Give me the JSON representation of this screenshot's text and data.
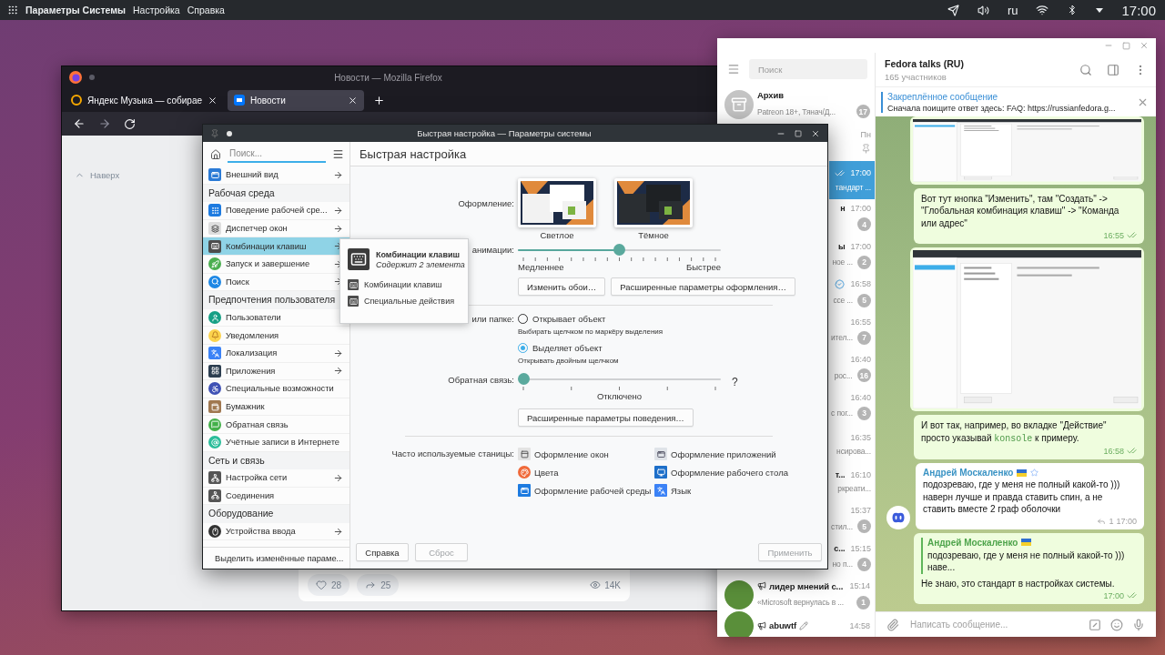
{
  "top_panel": {
    "app_title": "Параметры Системы",
    "menus": [
      "Настройка",
      "Справка"
    ],
    "keyboard_layout": "ru",
    "clock": "17:00"
  },
  "firefox": {
    "title": "Новости — Mozilla Firefox",
    "tabs": [
      {
        "label": "Яндекс Музыка — собирае",
        "selected": false
      },
      {
        "label": "Новости",
        "selected": true
      }
    ],
    "page": {
      "up_link": "Наверх",
      "likes": "28",
      "shares": "25",
      "views": "14K"
    }
  },
  "settings": {
    "title": "Быстрая настройка — Параметры системы",
    "search": {
      "placeholder": "Поиск..."
    },
    "sidebar": [
      {
        "kind": "item",
        "label": "Внешний вид",
        "arrow": true,
        "selected": false
      },
      {
        "kind": "header",
        "label": "Рабочая среда"
      },
      {
        "kind": "item",
        "label": "Поведение рабочей сре...",
        "arrow": true,
        "selected": false
      },
      {
        "kind": "item",
        "label": "Диспетчер окон",
        "arrow": true,
        "selected": false
      },
      {
        "kind": "item",
        "label": "Комбинации клавиш",
        "arrow": true,
        "selected": true
      },
      {
        "kind": "item",
        "label": "Запуск и завершение",
        "arrow": true,
        "selected": false
      },
      {
        "kind": "item",
        "label": "Поиск",
        "arrow": true,
        "selected": false
      },
      {
        "kind": "header",
        "label": "Предпочтения пользователя"
      },
      {
        "kind": "item",
        "label": "Пользователи",
        "arrow": false,
        "selected": false
      },
      {
        "kind": "item",
        "label": "Уведомления",
        "arrow": false,
        "selected": false
      },
      {
        "kind": "item",
        "label": "Локализация",
        "arrow": true,
        "selected": false
      },
      {
        "kind": "item",
        "label": "Приложения",
        "arrow": true,
        "selected": false
      },
      {
        "kind": "item",
        "label": "Специальные возможности",
        "arrow": false,
        "selected": false
      },
      {
        "kind": "item",
        "label": "Бумажник",
        "arrow": false,
        "selected": false
      },
      {
        "kind": "item",
        "label": "Обратная связь",
        "arrow": false,
        "selected": false
      },
      {
        "kind": "item",
        "label": "Учётные записи в Интернете",
        "arrow": false,
        "selected": false
      },
      {
        "kind": "header",
        "label": "Сеть и связь"
      },
      {
        "kind": "item",
        "label": "Настройка сети",
        "arrow": true,
        "selected": false
      },
      {
        "kind": "item",
        "label": "Соединения",
        "arrow": false,
        "selected": false
      },
      {
        "kind": "header",
        "label": "Оборудование"
      },
      {
        "kind": "item",
        "label": "Устройства ввода",
        "arrow": true,
        "selected": false
      }
    ],
    "highlight_changed": "Выделить изменённые параме...",
    "popup": {
      "title": "Комбинации клавиш",
      "subtitle": "Содержит 2 элемента",
      "items": [
        "Комбинации клавиш",
        "Специальные действия"
      ]
    },
    "page_title": "Быстрая настройка",
    "theme": {
      "label": "Оформление:",
      "options": [
        {
          "label": "Светлое",
          "kind": "light"
        },
        {
          "label": "Тёмное",
          "kind": "dark"
        }
      ]
    },
    "animation": {
      "label": "анимации:",
      "level": 0.5,
      "min_label": "Медленнее",
      "max_label": "Быстрее"
    },
    "appearance_buttons": [
      "Изменить обои…",
      "Расширенные параметры оформления…"
    ],
    "click_behavior": {
      "label": "или папке:",
      "options": [
        {
          "label": "Открывает объект",
          "hint": "Выбирать щелчком по маркёру выделения",
          "selected": false
        },
        {
          "label": "Выделяет объект",
          "hint": "Открывать двойным щелчком",
          "selected": true
        }
      ]
    },
    "feedback": {
      "label": "Обратная связь:",
      "level": 0,
      "value_label": "Отключено",
      "help": "?"
    },
    "behavior_button": "Расширенные параметры поведения…",
    "frequent": {
      "label": "Часто используемые станицы:",
      "links": [
        "Оформление окон",
        "Оформление приложений",
        "Цвета",
        "Оформление рабочего стола",
        "Оформление рабочей среды",
        "Язык"
      ]
    },
    "footer_buttons": [
      {
        "label": "Справка",
        "disabled": false
      },
      {
        "label": "Сброс",
        "disabled": true
      },
      {
        "label": "Применить",
        "disabled": true
      }
    ]
  },
  "telegram": {
    "search": {
      "placeholder": "Поиск"
    },
    "chats": [
      {
        "kind": "full",
        "title": "Архив",
        "preview": "Patreon 18+, Тянач/Д...",
        "badge": "17",
        "selected": false,
        "pinned": false,
        "read": false,
        "verified": false,
        "channel": false
      },
      {
        "kind": "partial",
        "time": "Пн",
        "selected": false,
        "pinned": true,
        "read": false,
        "verified": false,
        "channel": false
      },
      {
        "kind": "partial",
        "time": "17:00",
        "preview": "тандарт ...",
        "selected": true,
        "pinned": false,
        "read": true,
        "verified": false,
        "channel": false
      },
      {
        "kind": "partial",
        "title": "н",
        "time": "17:00",
        "badge": "4",
        "selected": false,
        "pinned": false,
        "read": false,
        "verified": false,
        "channel": false
      },
      {
        "kind": "partial",
        "title": "ы",
        "time": "17:00",
        "preview": "ное ...",
        "badge": "2",
        "selected": false,
        "pinned": false,
        "read": false,
        "verified": false,
        "channel": false
      },
      {
        "kind": "partial",
        "time": "16:58",
        "preview": "ссе ...",
        "badge": "5",
        "selected": false,
        "pinned": false,
        "read": false,
        "verified": true,
        "channel": false
      },
      {
        "kind": "partial",
        "time": "16:55",
        "preview": "ител...",
        "badge": "7",
        "selected": false,
        "pinned": false,
        "read": false,
        "verified": false,
        "channel": false
      },
      {
        "kind": "partial",
        "time": "16:40",
        "preview": "рос...",
        "badge": "16",
        "selected": false,
        "pinned": false,
        "read": false,
        "verified": false,
        "channel": false
      },
      {
        "kind": "partial",
        "time": "16:40",
        "preview": "с пог...",
        "badge": "3",
        "selected": false,
        "pinned": false,
        "read": false,
        "verified": false,
        "channel": false
      },
      {
        "kind": "partial",
        "time": "16:35",
        "preview": "нсирова...",
        "selected": false,
        "pinned": false,
        "read": false,
        "verified": false,
        "channel": false
      },
      {
        "kind": "partial",
        "title": "т...",
        "time": "16:10",
        "preview": "ркреати...",
        "selected": false,
        "pinned": false,
        "read": false,
        "verified": false,
        "channel": false
      },
      {
        "kind": "partial",
        "time": "15:37",
        "preview": "стил...",
        "badge": "5",
        "selected": false,
        "pinned": false,
        "read": false,
        "verified": false,
        "channel": false
      },
      {
        "kind": "partial",
        "title": "с...",
        "time": "15:15",
        "preview": "но п...",
        "badge": "4",
        "selected": false,
        "pinned": false,
        "read": false,
        "verified": false,
        "channel": false
      },
      {
        "kind": "full",
        "title": "лидер мнений с...",
        "time": "15:14",
        "preview": "«Microsoft вернулась в ...",
        "badge": "1",
        "selected": false,
        "pinned": false,
        "read": false,
        "verified": false,
        "channel": true
      },
      {
        "kind": "full",
        "title": "abuwtf",
        "time": "14:58",
        "selected": false,
        "pinned": false,
        "read": false,
        "verified": false,
        "channel": true
      }
    ],
    "chat": {
      "title": "Fedora talks (RU)",
      "subtitle": "165 участников"
    },
    "pinned_message": {
      "title": "Закреплённое сообщение",
      "text": "Сначала поищите ответ здесь: FAQ: https://russianfedora.g..."
    },
    "messages": [
      {
        "kind": "image",
        "outgoing": true
      },
      {
        "kind": "text",
        "outgoing": true,
        "parts": [
          {
            "kind": "plain",
            "text": "Вот тут кнопка \"Изменить\", там \"Создать\" -> \"Глобальная комбинация клавиш\" -> \"Команда или адрес\""
          }
        ],
        "time": "16:55",
        "read": true
      },
      {
        "kind": "image",
        "outgoing": true
      },
      {
        "kind": "text",
        "outgoing": true,
        "parts": [
          {
            "kind": "plain",
            "text": "И вот так, например, во вкладке \"Действие\" просто указывай "
          },
          {
            "kind": "code",
            "text": "konsole"
          },
          {
            "kind": "plain",
            "text": " к примеру."
          }
        ],
        "time": "16:58",
        "read": true
      },
      {
        "kind": "text",
        "outgoing": false,
        "author": "Андрей Москаленко",
        "parts": [
          {
            "kind": "plain",
            "text": "подозреваю, где у меня не полный какой-то ))) наверн лучше и правда ставить спин, а не ставить вместе 2 граф оболочки"
          }
        ],
        "replies": "1",
        "time": "17:00",
        "read": false
      },
      {
        "kind": "reply",
        "outgoing": true,
        "quote_author": "Андрей Москаленко",
        "quote_text": "подозреваю, где у меня не полный какой-то ))) наве...",
        "parts": [
          {
            "kind": "plain",
            "text": "Не знаю, это стандарт в настройках системы."
          }
        ],
        "time": "17:00",
        "read": true
      }
    ],
    "composer": {
      "placeholder": "Написать сообщение..."
    }
  }
}
